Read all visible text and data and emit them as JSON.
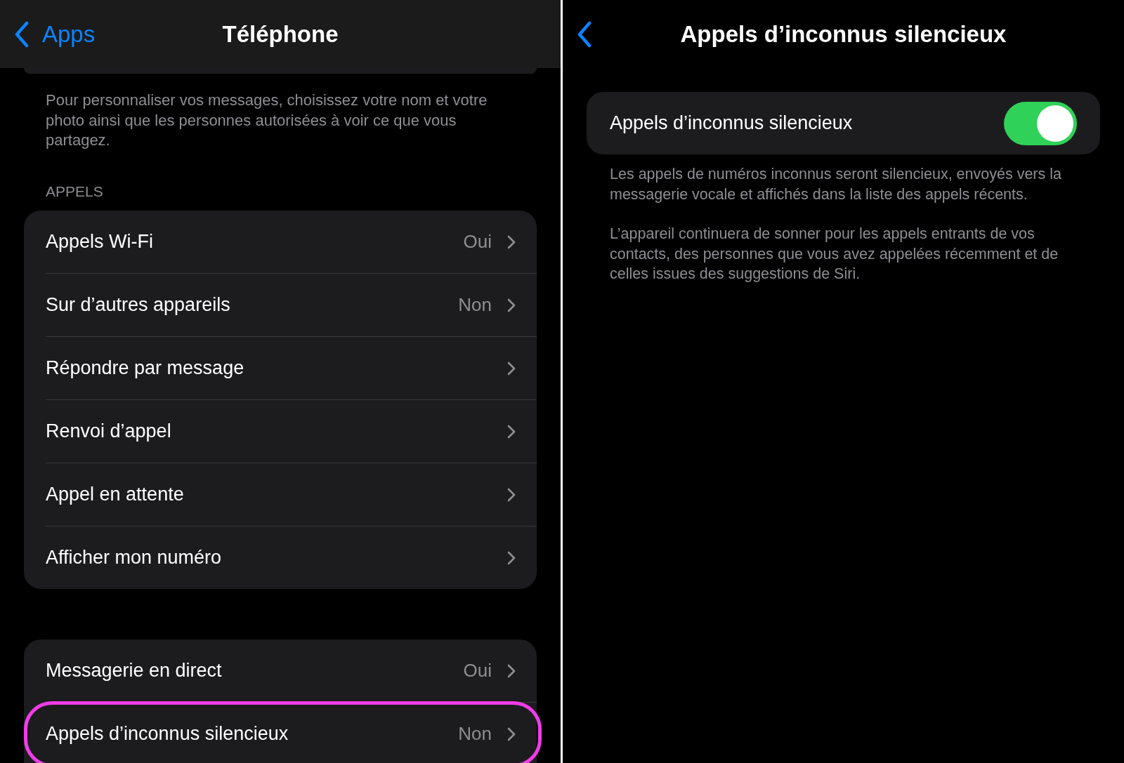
{
  "left": {
    "nav": {
      "back": "Apps",
      "title": "Téléphone"
    },
    "intro": "Pour personnaliser vos messages, choisissez votre nom et votre photo ainsi que les personnes autorisées à voir ce que vous partagez.",
    "sections": [
      {
        "header": "APPELS",
        "rows": [
          {
            "label": "Appels Wi-Fi",
            "value": "Oui",
            "highlighted": false
          },
          {
            "label": "Sur d’autres appareils",
            "value": "Non",
            "highlighted": false
          },
          {
            "label": "Répondre par message",
            "highlighted": false
          },
          {
            "label": "Renvoi d’appel",
            "highlighted": false
          },
          {
            "label": "Appel en attente",
            "highlighted": false
          },
          {
            "label": "Afficher mon numéro",
            "highlighted": false
          }
        ]
      },
      {
        "rows": [
          {
            "label": "Messagerie en direct",
            "value": "Oui",
            "highlighted": false
          },
          {
            "label": "Appels d’inconnus silencieux",
            "value": "Non",
            "highlighted": true
          }
        ]
      }
    ]
  },
  "right": {
    "nav": {
      "title": "Appels d’inconnus silencieux"
    },
    "toggle": {
      "label": "Appels d’inconnus silencieux",
      "on": true
    },
    "paragraphs": [
      "Les appels de numéros inconnus seront silencieux, envoyés vers la messagerie vocale et affichés dans la liste des appels récents.",
      "L’appareil continuera de sonner pour les appels entrants de vos contacts, des personnes que vous avez appelées récemment et de celles issues des suggestions de Siri."
    ]
  }
}
